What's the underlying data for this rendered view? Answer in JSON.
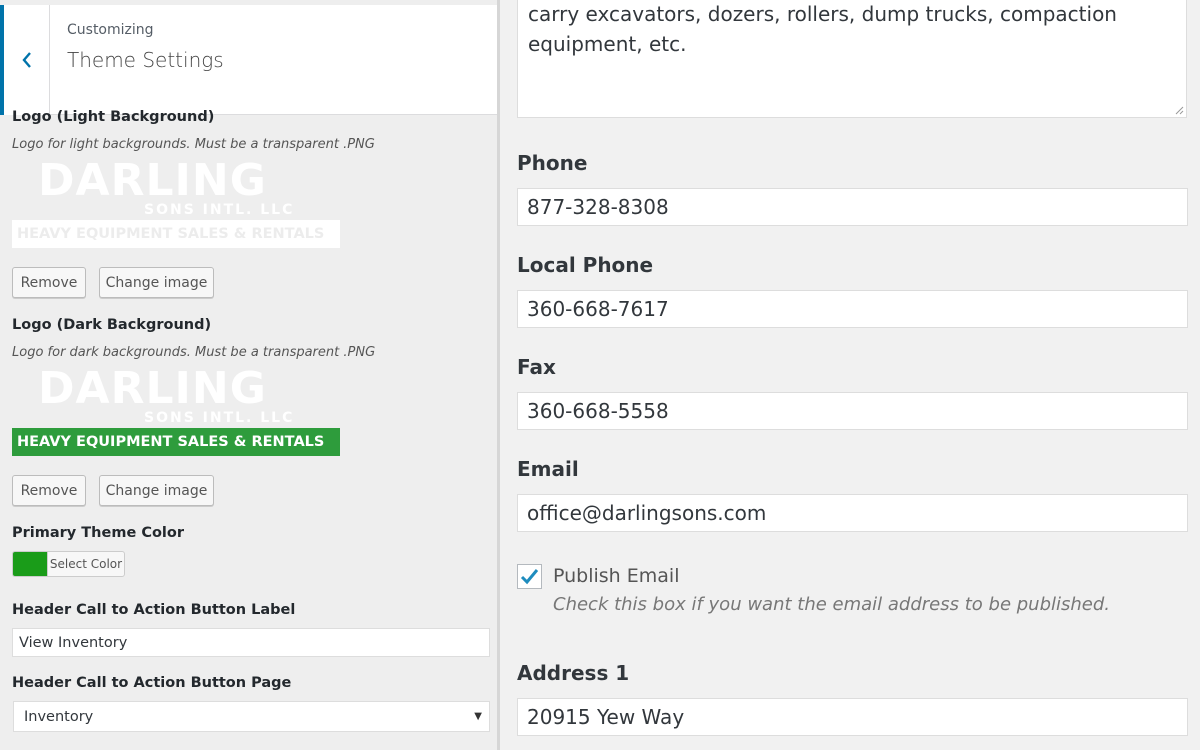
{
  "header": {
    "subtitle": "Customizing",
    "title": "Theme Settings",
    "back_icon": "chevron-left-icon"
  },
  "logo_light": {
    "label": "Logo (Light Background)",
    "description": "Logo for light backgrounds. Must be a transparent .PNG",
    "brand": "DARLING",
    "sub": "SONS INTL. LLC",
    "tagline": "HEAVY EQUIPMENT SALES & RENTALS",
    "remove_label": "Remove",
    "change_label": "Change image"
  },
  "logo_dark": {
    "label": "Logo (Dark Background)",
    "description": "Logo for dark backgrounds. Must be a transparent .PNG",
    "brand": "DARLING",
    "sub": "SONS INTL. LLC",
    "tagline": "HEAVY EQUIPMENT SALES & RENTALS",
    "remove_label": "Remove",
    "change_label": "Change image",
    "band_color": "#2e9c3c"
  },
  "primary_color": {
    "label": "Primary Theme Color",
    "button_label": "Select Color",
    "value": "#1a9c19"
  },
  "cta_label": {
    "label": "Header Call to Action Button Label",
    "value": "View Inventory"
  },
  "cta_page": {
    "label": "Header Call to Action Button Page",
    "value": "Inventory"
  },
  "description_text": {
    "line1": "carry excavators, dozers, rollers, dump trucks, compaction",
    "line2": "equipment, etc."
  },
  "phone": {
    "label": "Phone",
    "value": "877-328-8308"
  },
  "local_phone": {
    "label": "Local Phone",
    "value": "360-668-7617"
  },
  "fax": {
    "label": "Fax",
    "value": "360-668-5558"
  },
  "email": {
    "label": "Email",
    "value": "office@darlingsons.com"
  },
  "publish_email": {
    "label": "Publish Email",
    "description": "Check this box if you want the email address to be published.",
    "checked": true
  },
  "address1": {
    "label": "Address 1",
    "value": "20915 Yew Way"
  },
  "colors": {
    "accent": "#0073aa",
    "check": "#1e8cbe"
  }
}
